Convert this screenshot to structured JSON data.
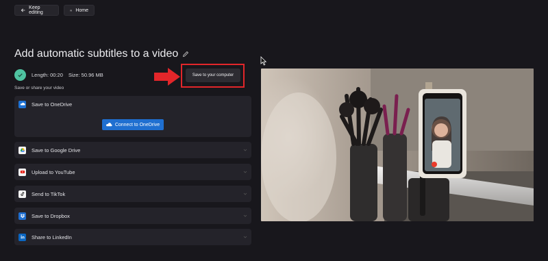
{
  "topbar": {
    "keep_editing_label": "Keep editing",
    "home_label": "Home"
  },
  "page": {
    "title": "Add automatic subtitles to a video",
    "length_text": "Length: 00:20",
    "size_text": "Size: 50.96 MB",
    "save_computer_label": "Save to your computer",
    "subhead": "Save or share your video"
  },
  "onedrive": {
    "label": "Save to OneDrive",
    "connect_label": "Connect to OneDrive"
  },
  "services": [
    {
      "label": "Save to Google Drive",
      "icon": "google-drive-icon"
    },
    {
      "label": "Upload to YouTube",
      "icon": "youtube-icon"
    },
    {
      "label": "Send to TikTok",
      "icon": "tiktok-icon"
    },
    {
      "label": "Save to Dropbox",
      "icon": "dropbox-icon"
    },
    {
      "label": "Share to LinkedIn",
      "icon": "linkedin-icon"
    }
  ],
  "colors": {
    "background": "#18171c",
    "panel": "#24232a",
    "accent_green": "#4fc3a1",
    "accent_blue": "#1f6fd0",
    "highlight_red": "#e3262a"
  }
}
